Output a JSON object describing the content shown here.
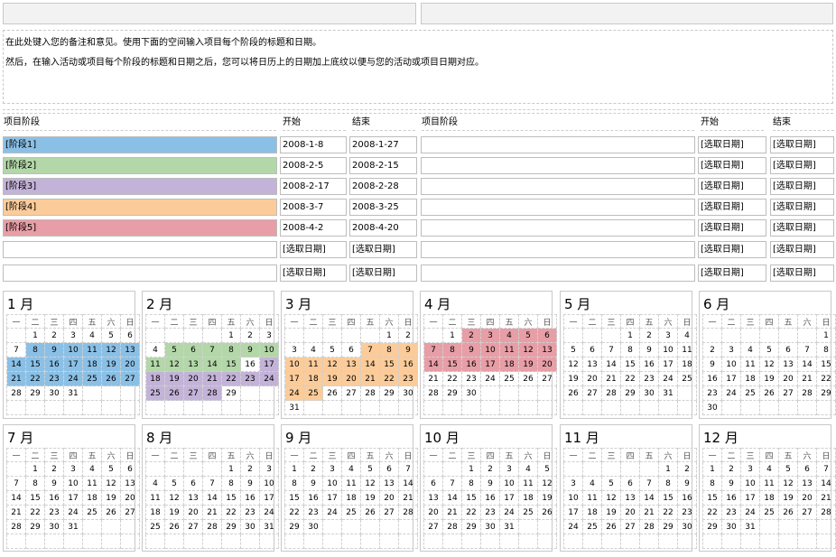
{
  "top_fields": [
    "",
    ""
  ],
  "notes": [
    "在此处键入您的备注和意见。使用下面的空间输入项目每个阶段的标题和日期。",
    "然后，在输入活动或项目每个阶段的标题和日期之后，您可以将日历上的日期加上底纹以便与您的活动或项目日期对应。"
  ],
  "headers": {
    "phase": "项目阶段",
    "start": "开始",
    "end": "结束"
  },
  "colors": {
    "p1": "#8bc0e6",
    "p2": "#b3d7a8",
    "p3": "#c4b3d8",
    "p4": "#fbcc9a",
    "p5": "#e79ea6"
  },
  "phases_left": [
    {
      "name": "[阶段1]",
      "start": "2008-1-8",
      "end": "2008-1-27",
      "color": "#8bc0e6"
    },
    {
      "name": "[阶段2]",
      "start": "2008-2-5",
      "end": "2008-2-15",
      "color": "#b3d7a8"
    },
    {
      "name": "[阶段3]",
      "start": "2008-2-17",
      "end": "2008-2-28",
      "color": "#c4b3d8"
    },
    {
      "name": "[阶段4]",
      "start": "2008-3-7",
      "end": "2008-3-25",
      "color": "#fbcc9a"
    },
    {
      "name": "[阶段5]",
      "start": "2008-4-2",
      "end": "2008-4-20",
      "color": "#e79ea6"
    },
    {
      "name": "",
      "start": "[选取日期]",
      "end": "[选取日期]",
      "color": ""
    },
    {
      "name": "",
      "start": "[选取日期]",
      "end": "[选取日期]",
      "color": ""
    }
  ],
  "phases_right": [
    {
      "name": "",
      "start": "[选取日期]",
      "end": "[选取日期]"
    },
    {
      "name": "",
      "start": "[选取日期]",
      "end": "[选取日期]"
    },
    {
      "name": "",
      "start": "[选取日期]",
      "end": "[选取日期]"
    },
    {
      "name": "",
      "start": "[选取日期]",
      "end": "[选取日期]"
    },
    {
      "name": "",
      "start": "[选取日期]",
      "end": "[选取日期]"
    },
    {
      "name": "",
      "start": "[选取日期]",
      "end": "[选取日期]"
    },
    {
      "name": "",
      "start": "[选取日期]",
      "end": "[选取日期]"
    }
  ],
  "weekdays": [
    "一",
    "二",
    "三",
    "四",
    "五",
    "六",
    "日"
  ],
  "months": [
    {
      "title": "1 月",
      "offset": 1,
      "days": 31
    },
    {
      "title": "2 月",
      "offset": 4,
      "days": 29
    },
    {
      "title": "3 月",
      "offset": 5,
      "days": 31
    },
    {
      "title": "4 月",
      "offset": 1,
      "days": 30
    },
    {
      "title": "5 月",
      "offset": 3,
      "days": 31
    },
    {
      "title": "6 月",
      "offset": 6,
      "days": 30
    },
    {
      "title": "7 月",
      "offset": 1,
      "days": 31
    },
    {
      "title": "8 月",
      "offset": 4,
      "days": 31
    },
    {
      "title": "9 月",
      "offset": 0,
      "days": 30
    },
    {
      "title": "10 月",
      "offset": 2,
      "days": 31
    },
    {
      "title": "11 月",
      "offset": 5,
      "days": 30
    },
    {
      "title": "12 月",
      "offset": 0,
      "days": 31
    }
  ],
  "shading": [
    {
      "month": 1,
      "from": 8,
      "to": 27,
      "color": "#8bc0e6"
    },
    {
      "month": 2,
      "from": 5,
      "to": 15,
      "color": "#b3d7a8"
    },
    {
      "month": 2,
      "from": 17,
      "to": 28,
      "color": "#c4b3d8"
    },
    {
      "month": 3,
      "from": 7,
      "to": 25,
      "color": "#fbcc9a"
    },
    {
      "month": 4,
      "from": 2,
      "to": 20,
      "color": "#e79ea6"
    }
  ]
}
